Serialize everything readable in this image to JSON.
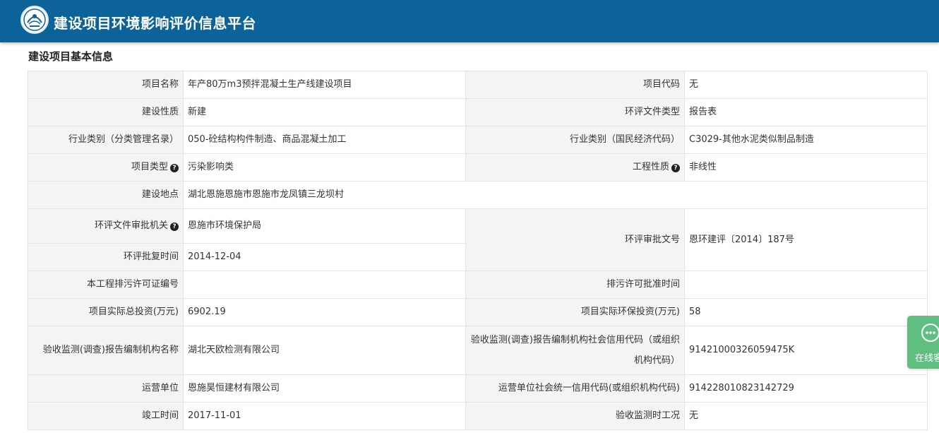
{
  "header": {
    "title": "建设项目环境影响评价信息平台"
  },
  "section": {
    "title": "建设项目基本信息"
  },
  "fields": {
    "project_name": {
      "label": "项目名称",
      "value": "年产80万m3预拌混凝土生产线建设项目"
    },
    "project_code": {
      "label": "项目代码",
      "value": "无"
    },
    "construction_nature": {
      "label": "建设性质",
      "value": "新建"
    },
    "eia_doc_type": {
      "label": "环评文件类型",
      "value": "报告表"
    },
    "industry_category_mgmt": {
      "label": "行业类别（分类管理名录）",
      "value": "050-砼结构构件制造、商品混凝土加工"
    },
    "industry_category_econ": {
      "label": "行业类别（国民经济代码）",
      "value": "C3029-其他水泥类似制品制造"
    },
    "project_type": {
      "label": "项目类型",
      "value": "污染影响类"
    },
    "engineering_nature": {
      "label": "工程性质",
      "value": "非线性"
    },
    "location": {
      "label": "建设地点",
      "value": "湖北恩施恩施市恩施市龙凤镇三龙坝村"
    },
    "approval_authority": {
      "label": "环评文件审批机关",
      "value": "恩施市环境保护局"
    },
    "approval_doc_no": {
      "label": "环评审批文号",
      "value": "恩环建评〔2014〕187号"
    },
    "approval_date": {
      "label": "环评批复时间",
      "value": "2014-12-04"
    },
    "discharge_permit_no": {
      "label": "本工程排污许可证编号",
      "value": ""
    },
    "discharge_permit_date": {
      "label": "排污许可批准时间",
      "value": ""
    },
    "total_investment": {
      "label": "项目实际总投资(万元)",
      "value": "6902.19"
    },
    "env_investment": {
      "label": "项目实际环保投资(万元)",
      "value": "58"
    },
    "monitor_org_name": {
      "label": "验收监测(调查)报告编制机构名称",
      "value": "湖北天欧检测有限公司"
    },
    "monitor_org_credit_code": {
      "label": "验收监测(调查)报告编制机构社会信用代码（或组织机构代码）",
      "value": "91421000326059475K"
    },
    "operator": {
      "label": "运营单位",
      "value": "恩施昊恒建材有限公司"
    },
    "operator_credit_code": {
      "label": "运营单位社会统一信用代码(或组织机构代码)",
      "value": "914228010823142729"
    },
    "completion_date": {
      "label": "竣工时间",
      "value": "2017-11-01"
    },
    "acceptance_condition": {
      "label": "验收监测时工况",
      "value": "无"
    }
  },
  "icons": {
    "help": "question-circle-icon",
    "chat": "chat-bubble-icon",
    "logo": "mee-emblem-icon"
  },
  "help_glyph": "?",
  "chat": {
    "label": "在线客服"
  },
  "colors": {
    "header_bg": "#0b6399",
    "label_bg": "#f4f4f4",
    "border": "#e4e4e4",
    "chat_bg": "#5fbf80"
  }
}
